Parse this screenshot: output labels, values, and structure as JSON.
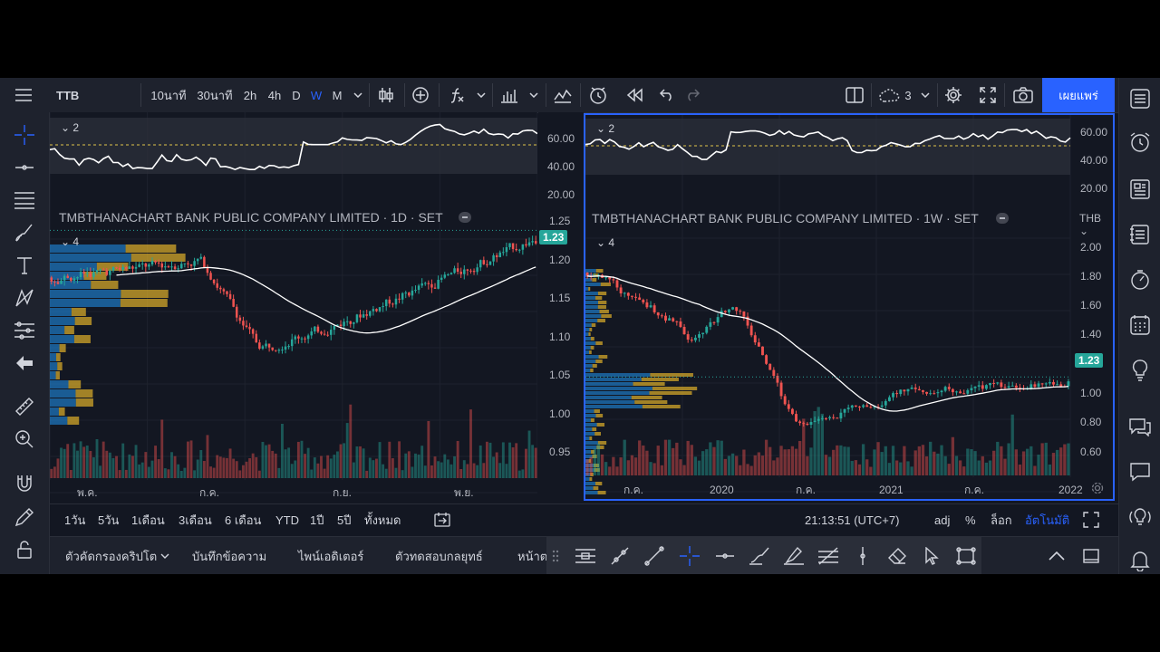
{
  "app": {
    "symbol": "TTB",
    "intervals": [
      "10นาที",
      "30นาที",
      "2h",
      "4h",
      "D",
      "W",
      "M"
    ],
    "active_interval": "W",
    "layout_count": "3",
    "publish_label": "เผยแพร่"
  },
  "left_chart": {
    "title": "TMBTHANACHART BANK PUBLIC COMPANY LIMITED · 1D · SET",
    "osc_label": "2",
    "main_label": "4",
    "osc_axis": [
      "60.00",
      "40.00",
      "20.00"
    ],
    "price_axis": [
      "1.25",
      "1.20",
      "1.15",
      "1.10",
      "1.05",
      "1.00",
      "0.95"
    ],
    "last_price": "1.23",
    "dates": [
      "พ.ค.",
      "ก.ค.",
      "ก.ย.",
      "พ.ย."
    ]
  },
  "right_chart": {
    "title": "TMBTHANACHART BANK PUBLIC COMPANY LIMITED · 1W · SET",
    "osc_label": "2",
    "main_label": "4",
    "currency": "THB",
    "osc_axis": [
      "60.00",
      "40.00",
      "20.00"
    ],
    "price_axis": [
      "2.00",
      "1.80",
      "1.60",
      "1.40",
      "1.00",
      "0.80",
      "0.60"
    ],
    "last_price": "1.23",
    "dates": [
      "ก.ค.",
      "2020",
      "ก.ค.",
      "2021",
      "ก.ค.",
      "2022"
    ]
  },
  "range_bar": {
    "ranges": [
      "1วัน",
      "5วัน",
      "1เดือน",
      "3เดือน",
      "6 เดือน",
      "YTD",
      "1ปี",
      "5ปี",
      "ทั้งหมด"
    ],
    "clock": "21:13:51 (UTC+7)",
    "adj": "adj",
    "percent": "%",
    "log": "ล็อก",
    "auto": "อัตโนมัติ"
  },
  "bottom_tabs": [
    "ตัวคัดกรองคริปโต",
    "บันทึกข้อความ",
    "ไพน์เอดิเตอร์",
    "ตัวทดสอบกลยุทธ์",
    "หน้าต"
  ],
  "colors": {
    "up": "#26a69a",
    "down": "#ef5350",
    "accent": "#2962ff",
    "volume_profile_blue": "#2196f3",
    "volume_profile_gold": "#e0b02a"
  }
}
